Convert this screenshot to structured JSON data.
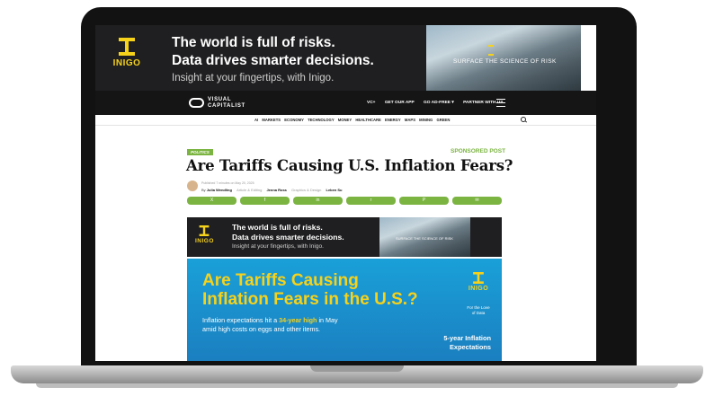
{
  "top_ad": {
    "logo": "INIGO",
    "line1": "The world is full of risks.",
    "line2": "Data drives smarter decisions.",
    "line3": "Insight at your fingertips, with Inigo.",
    "photo_tag": "SURFACE THE SCIENCE OF RISK"
  },
  "nav": {
    "logo_line1": "VISUAL",
    "logo_line2": "CAPITALIST",
    "vc_plus": "VC+",
    "get_app": "GET OUR APP",
    "go_ad_free": "GO AD-FREE ▾",
    "partner": "PARTNER WITH US"
  },
  "categories": [
    "AI",
    "MARKETS",
    "ECONOMY",
    "TECHNOLOGY",
    "MONEY",
    "HEALTHCARE",
    "ENERGY",
    "MAPS",
    "MINING",
    "GREEN"
  ],
  "article": {
    "category_badge": "POLITICS",
    "sponsored": "SPONSORED POST",
    "title": "Are Tariffs Causing U.S. Inflation Fears?",
    "published": "Published 7 minutes on May 20, 2025",
    "by": "By",
    "author": "Julia Wendling",
    "author_role": "Article & Editing",
    "designer": "Jenna Ross",
    "designer_role": "Graphics & Design",
    "third": "Leben Su"
  },
  "share_buttons": [
    "X",
    "f",
    "in",
    "r",
    "P",
    "✉"
  ],
  "inline_ad": {
    "logo": "INIGO",
    "line1": "The world is full of risks.",
    "line2": "Data drives smarter decisions.",
    "line3": "Insight at your fingertips, with Inigo.",
    "photo_tag": "SURFACE THE SCIENCE OF RISK"
  },
  "infographic": {
    "headline1": "Are Tariffs Causing",
    "headline2": "Inflation Fears in the U.S.?",
    "sub1_pre": "Inflation expectations hit a ",
    "sub1_hl": "34-year high",
    "sub1_post": " in May",
    "sub2": "amid high costs on eggs and other items.",
    "logo": "INIGO",
    "tagline1": "For the Love",
    "tagline2": "of Data",
    "label1": "5-year Inflation",
    "label2": "Expectations"
  }
}
